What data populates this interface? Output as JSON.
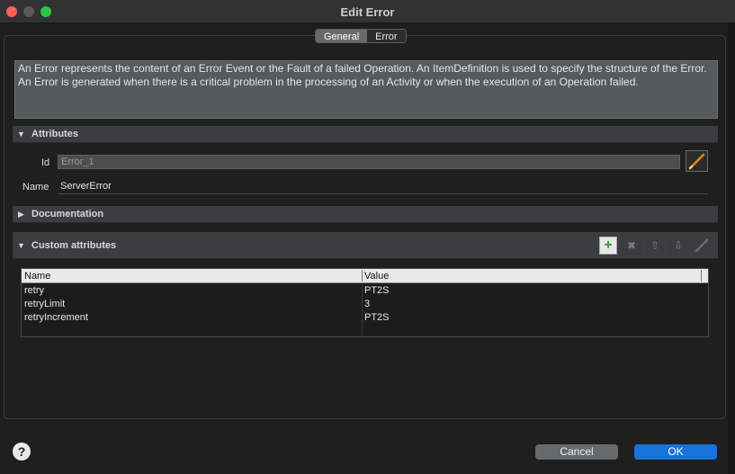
{
  "window": {
    "title": "Edit Error"
  },
  "tabs": [
    {
      "label": "General",
      "active": true
    },
    {
      "label": "Error",
      "active": false
    }
  ],
  "description": "An Error represents the content of an Error Event or the Fault of a failed Operation. An ItemDefinition is used to specify the structure of the Error. An Error is generated when there is a critical problem in the processing of an Activity or when the execution of an Operation failed.",
  "sections": {
    "attributes": "Attributes",
    "documentation": "Documentation",
    "custom_attributes": "Custom attributes"
  },
  "fields": {
    "id_label": "Id",
    "id_value": "Error_1",
    "name_label": "Name",
    "name_value": "ServerError"
  },
  "table": {
    "headers": [
      "Name",
      "Value"
    ],
    "rows": [
      {
        "name": "retry",
        "value": "PT2S"
      },
      {
        "name": "retryLimit",
        "value": "3"
      },
      {
        "name": "retryIncrement",
        "value": "PT2S"
      }
    ]
  },
  "toolbar": {
    "icons": [
      "add-icon",
      "remove-icon",
      "move-up-icon",
      "move-down-icon",
      "edit-pencil-icon"
    ]
  },
  "footer": {
    "help_label": "?",
    "cancel_label": "Cancel",
    "ok_label": "OK"
  },
  "colors": {
    "ok_button": "#1673d9",
    "close": "#ff5f57",
    "maximize": "#28c840",
    "add_icon": "#2e9a2e",
    "pencil": "#e08a20"
  }
}
